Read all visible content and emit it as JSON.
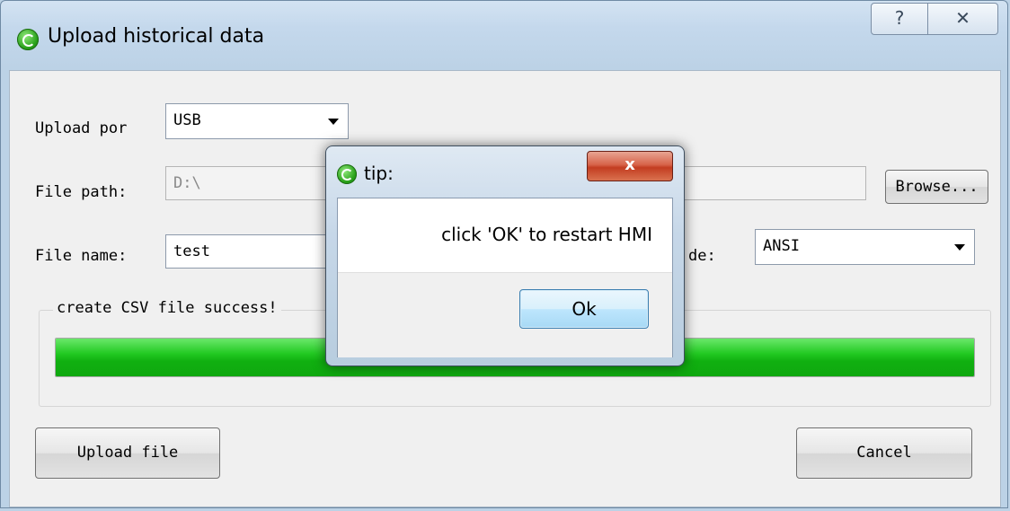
{
  "window": {
    "title": "Upload historical data",
    "help_glyph": "?",
    "close_glyph": "✕"
  },
  "form": {
    "upload_port_label": "Upload por",
    "upload_port_value": "USB",
    "file_path_label": "File path:",
    "file_path_value": "D:\\",
    "browse_label": "Browse...",
    "file_name_label": "File name:",
    "file_name_value": "test",
    "encode_label_visible": "de:",
    "encode_value": "ANSI"
  },
  "status": {
    "group_title": "create CSV file success!",
    "progress_fraction": 1.0
  },
  "buttons": {
    "upload_label": "Upload file",
    "cancel_label": "Cancel"
  },
  "tip_dialog": {
    "title": "tip:",
    "close_glyph": "x",
    "message": "click 'OK' to restart HMI",
    "ok_label": "Ok"
  },
  "icons": {
    "app": "refresh-circle-icon",
    "combo_arrow": "chevron-down-icon"
  },
  "colors": {
    "progress_green": "#22c922",
    "close_red": "#c33d21"
  }
}
